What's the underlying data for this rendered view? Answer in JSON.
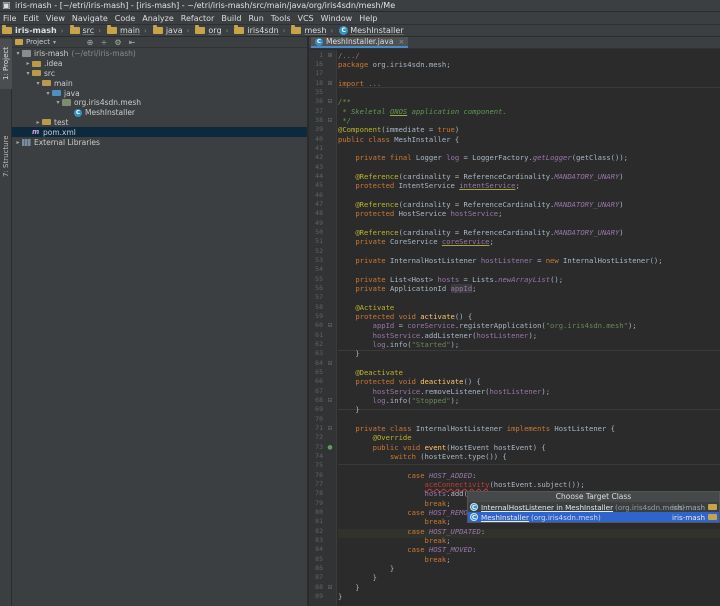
{
  "window": {
    "title": "iris-mash - [~/etri/iris-mash] - [iris-mash] - ~/etri/iris-mash/src/main/java/org/iris4sdn/mesh/Me"
  },
  "menu": [
    "File",
    "Edit",
    "View",
    "Navigate",
    "Code",
    "Analyze",
    "Refactor",
    "Build",
    "Run",
    "Tools",
    "VCS",
    "Window",
    "Help"
  ],
  "breadcrumb": [
    "iris-mash",
    "src",
    "main",
    "java",
    "org",
    "iris4sdn",
    "mesh",
    "MeshInstaller"
  ],
  "left_tabs": {
    "project": "1: Project",
    "structure": "7: Structure"
  },
  "project_panel": {
    "view_label": "Project",
    "tree": [
      {
        "label": "iris-mash",
        "sub": "(~/etri/iris-mash)"
      },
      {
        "label": ".idea"
      },
      {
        "label": "src"
      },
      {
        "label": "main"
      },
      {
        "label": "java"
      },
      {
        "label": "org.iris4sdn.mesh"
      },
      {
        "label": "MeshInstaller"
      },
      {
        "label": "test"
      },
      {
        "label": "pom.xml"
      },
      {
        "label": "External Libraries"
      }
    ]
  },
  "editor": {
    "tab_label": "MeshInstaller.java",
    "line_numbers": [
      "1",
      "16",
      "17",
      "18",
      "35",
      "36",
      "37",
      "38",
      "39",
      "40",
      "41",
      "42",
      "43",
      "44",
      "45",
      "46",
      "47",
      "48",
      "49",
      "50",
      "51",
      "52",
      "53",
      "54",
      "55",
      "56",
      "57",
      "58",
      "59",
      "60",
      "61",
      "62",
      "63",
      "64",
      "65",
      "66",
      "67",
      "68",
      "69",
      "70",
      "71",
      "72",
      "73",
      "74",
      "75",
      "76",
      "77",
      "78",
      "79",
      "80",
      "81",
      "82",
      "83",
      "84",
      "85",
      "86",
      "87",
      "88",
      "89"
    ]
  },
  "popup": {
    "title": "Choose Target Class",
    "options": [
      {
        "name": "InternalHostListener in MeshInstaller",
        "pkg": "(org.iris4sdn.mesh)",
        "module": "iris-mash"
      },
      {
        "name": "MeshInstaller",
        "pkg": "(org.iris4sdn.mesh)",
        "module": "iris-mash"
      }
    ]
  },
  "colors": {
    "editor_bg": "#2b2b2b",
    "panel_bg": "#3c3f41",
    "keyword": "#cc7832",
    "annotation": "#bbb529",
    "string": "#6a8759",
    "field": "#9876aa",
    "selection": "#2f65ca"
  }
}
